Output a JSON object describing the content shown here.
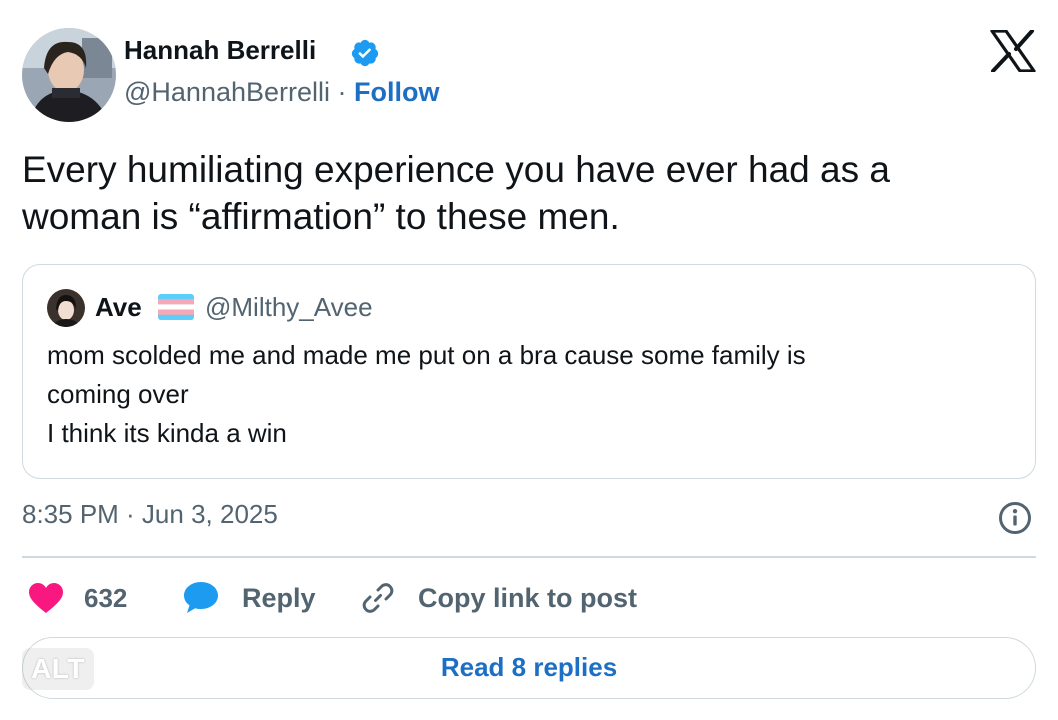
{
  "author": {
    "name": "Hannah Berrelli",
    "handle": "@HannahBerrelli",
    "separator": "·",
    "follow_label": "Follow",
    "avatar_icon": "profile-photo",
    "verified_icon": "verified-badge-icon"
  },
  "brand": {
    "logo": "x-logo-icon"
  },
  "tweet": {
    "line1": "Every humiliating experience you have ever had as a",
    "line2": "woman is “affirmation” to these men."
  },
  "quoted": {
    "name": "Ave",
    "flag": "trans-flag-emoji",
    "handle": "@Milthy_Avee",
    "lines": [
      "mom scolded me and made me put on a bra cause some family is",
      "coming over",
      "I think its kinda a win"
    ]
  },
  "meta": {
    "timestamp": "8:35 PM · Jun 3, 2025",
    "info_icon": "info-icon"
  },
  "actions": {
    "like_count": "632",
    "reply_label": "Reply",
    "copy_label": "Copy link to post"
  },
  "footer": {
    "read_replies": "Read 8 replies",
    "alt_badge": "ALT"
  },
  "colors": {
    "link": "#1d6fc4",
    "secondary_text": "#536471",
    "border": "#cfd9de",
    "heart": "#f91880",
    "bubble": "#1d9bf0"
  }
}
